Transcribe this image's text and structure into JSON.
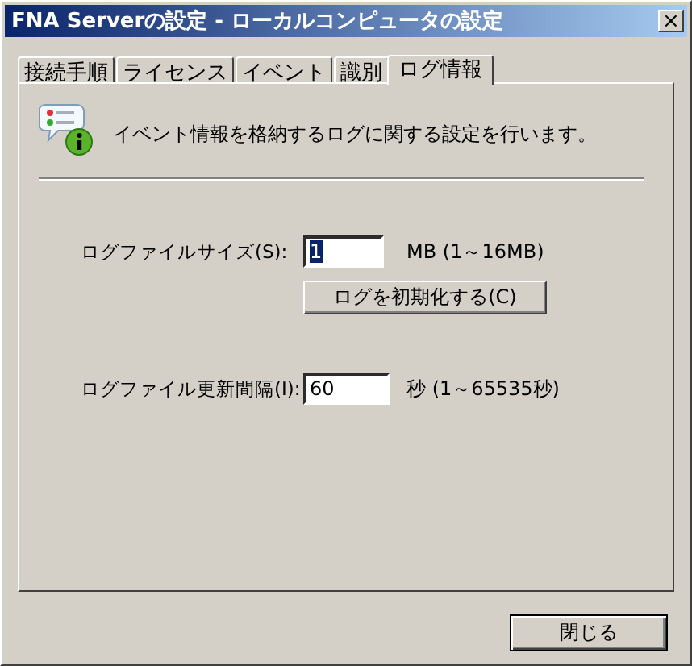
{
  "window": {
    "title": "FNA Serverの設定 - ローカルコンピュータの設定",
    "close_glyph": "×"
  },
  "tabs": [
    {
      "label": "接続手順",
      "selected": false
    },
    {
      "label": "ライセンス",
      "selected": false
    },
    {
      "label": "イベント",
      "selected": false
    },
    {
      "label": "識別",
      "selected": false
    },
    {
      "label": "ログ情報",
      "selected": true
    }
  ],
  "description": "イベント情報を格納するログに関する設定を行います。",
  "log_size": {
    "label": "ログファイルサイズ(S):",
    "value": "1",
    "value_selected": true,
    "unit": "MB (1～16MB)"
  },
  "reset_button": "ログを初期化する(C)",
  "update_interval": {
    "label": "ログファイル更新間隔(I):",
    "value": "60",
    "unit": "秒 (1～65535秒)"
  },
  "buttons": [
    "閉じる"
  ]
}
